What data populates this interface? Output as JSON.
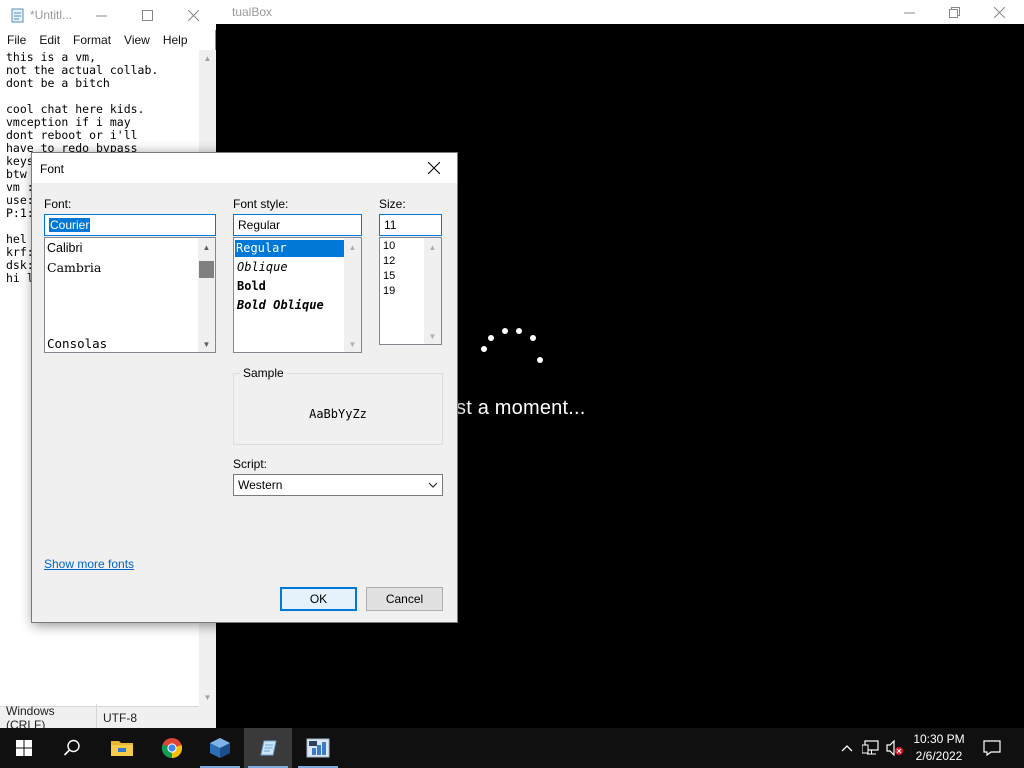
{
  "vbox": {
    "title_fragment": "tualBox",
    "vm_message": "st a moment..."
  },
  "notepad": {
    "title": "*Untitl...",
    "menu": [
      {
        "label": "File"
      },
      {
        "label": "Edit"
      },
      {
        "label": "Format"
      },
      {
        "label": "View"
      },
      {
        "label": "Help"
      }
    ],
    "text_lines": [
      "this is a vm,",
      "not the actual collab.",
      "dont be a bitch",
      "",
      "cool chat here kids.",
      "vmception if i may",
      "dont reboot or i'll",
      "have to redo bypass",
      "keys",
      "btw",
      "vm :",
      "use:",
      "P:1:",
      "",
      "hel",
      "krf:",
      "dsk:",
      "hi l"
    ],
    "status_eol": "Windows (CRLF)",
    "status_encoding": "UTF-8"
  },
  "font_dialog": {
    "title": "Font",
    "font_label": "Font:",
    "font_value": "Courier",
    "font_list": [
      {
        "label": "Calibri"
      },
      {
        "label": "Cambria"
      },
      {
        "label": "Consolas"
      }
    ],
    "style_label": "Font style:",
    "style_value": "Regular",
    "style_list": [
      {
        "label": "Regular",
        "selected": true
      },
      {
        "label": "Oblique"
      },
      {
        "label": "Bold"
      },
      {
        "label": "Bold Oblique"
      }
    ],
    "size_label": "Size:",
    "size_value": "11",
    "size_list": [
      {
        "label": "10"
      },
      {
        "label": "12"
      },
      {
        "label": "15"
      },
      {
        "label": "19"
      }
    ],
    "sample_label": "Sample",
    "sample_text": "AaBbYyZz",
    "script_label": "Script:",
    "script_value": "Western",
    "show_more_fonts": "Show more fonts",
    "ok_label": "OK",
    "cancel_label": "Cancel",
    "accent_color": "#0078d7"
  },
  "taskbar": {
    "items": [
      {
        "icon": "windows-start-icon"
      },
      {
        "icon": "search-icon"
      },
      {
        "icon": "file-explorer-icon"
      },
      {
        "icon": "chrome-icon"
      },
      {
        "icon": "virtualbox-icon"
      },
      {
        "icon": "notepad-icon",
        "active": true
      },
      {
        "icon": "system-info-icon"
      }
    ],
    "clock_time": "10:30 PM",
    "clock_date": "2/6/2022"
  }
}
